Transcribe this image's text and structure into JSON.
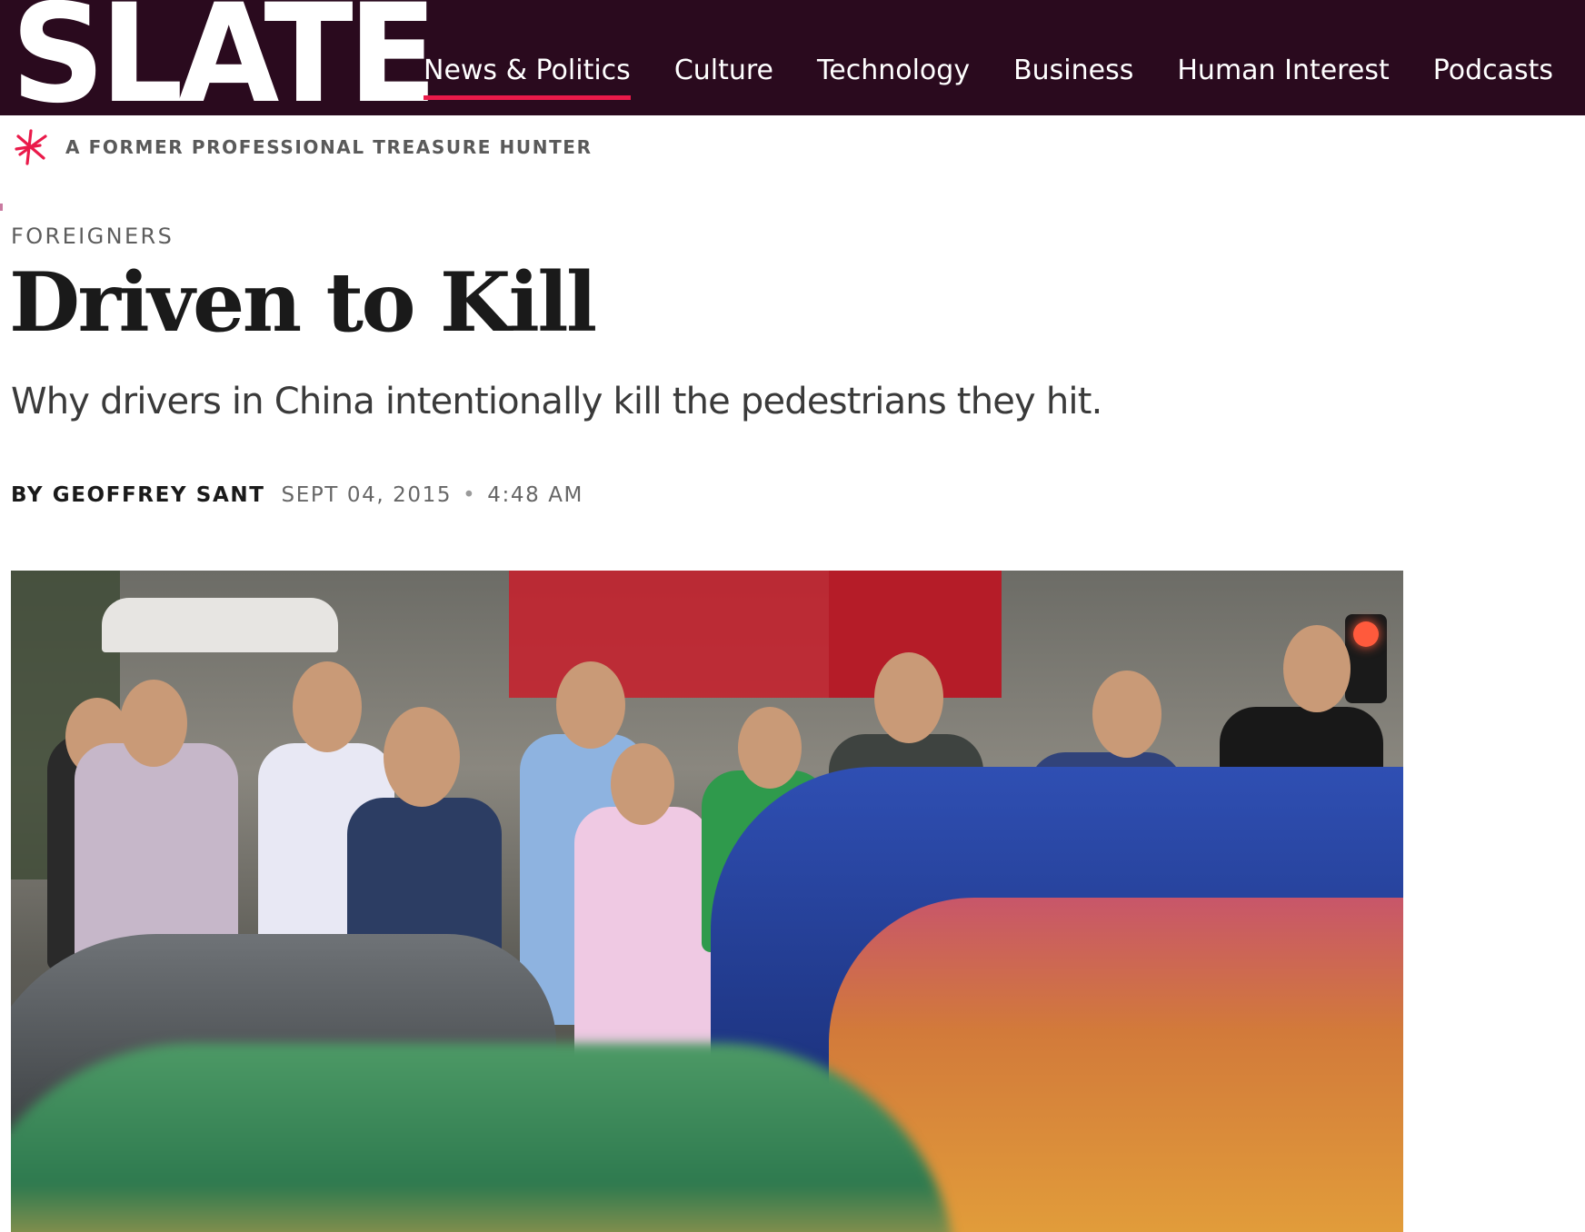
{
  "header": {
    "logo": "SLATE",
    "nav": [
      {
        "label": "News & Politics",
        "active": true
      },
      {
        "label": "Culture",
        "active": false
      },
      {
        "label": "Technology",
        "active": false
      },
      {
        "label": "Business",
        "active": false
      },
      {
        "label": "Human Interest",
        "active": false
      },
      {
        "label": "Podcasts",
        "active": false
      }
    ],
    "accent_color": "#ea1a4a",
    "bar_color": "#2a0a1e"
  },
  "series": {
    "icon": "slate-star-icon",
    "label": "A FORMER PROFESSIONAL TREASURE HUNTER"
  },
  "article": {
    "kicker": "FOREIGNERS",
    "headline": "Driven to Kill",
    "dek": "Why drivers in China intentionally kill the pedestrians they hit.",
    "byline": {
      "author": "BY GEOFFREY SANT",
      "date": "SEPT 04, 2015",
      "separator": "•",
      "time": "4:48 AM"
    },
    "hero_image": {
      "description_icon": "photo-icon"
    }
  }
}
